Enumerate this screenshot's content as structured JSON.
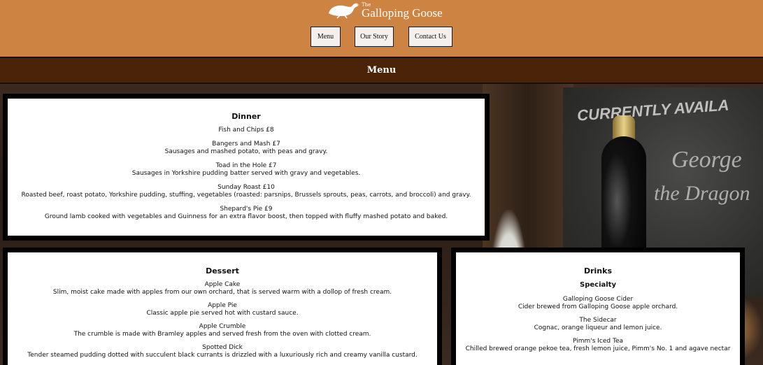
{
  "header": {
    "logo_small": "The",
    "logo_name": "Galloping Goose",
    "nav": [
      "Menu",
      "Our Story",
      "Contact Us"
    ]
  },
  "title_bar": {
    "title": "Menu"
  },
  "background": {
    "chalk_lines": [
      "CURRENTLY AVAILA",
      "George",
      "the Dragon"
    ]
  },
  "dinner": {
    "heading": "Dinner",
    "items": [
      {
        "name": "Fish and Chips £8",
        "desc": ""
      },
      {
        "name": "Bangers and Mash £7",
        "desc": "Sausages and mashed potato, with peas and gravy."
      },
      {
        "name": "Toad in the Hole £7",
        "desc": "Sausages in Yorkshire pudding batter served with gravy and vegetables."
      },
      {
        "name": "Sunday Roast £10",
        "desc": "Roasted beef, roast potato, Yorkshire pudding, stuffing, vegetables (roasted: parsnips, Brussels sprouts, peas, carrots, and broccoli) and gravy."
      },
      {
        "name": "Shepard's Pie £9",
        "desc": "Ground lamb cooked with vegetables and Guinness for an extra flavor boost, then topped with fluffy mashed potato and baked."
      }
    ]
  },
  "dessert": {
    "heading": "Dessert",
    "items": [
      {
        "name": "Apple Cake",
        "desc": "Slim, moist cake made with apples from our own orchard, that is served warm with a dollop of fresh cream."
      },
      {
        "name": "Apple Pie",
        "desc": "Classic apple pie served hot with custard sauce."
      },
      {
        "name": "Apple Crumble",
        "desc": "The crumble is made with Bramley apples and served fresh from the oven with clotted cream."
      },
      {
        "name": "Spotted Dick",
        "desc": "Tender steamed pudding dotted with succulent black currants is drizzled with a luxuriously rich and creamy vanilla custard."
      }
    ]
  },
  "drinks": {
    "heading": "Drinks",
    "subheading": "Specialty",
    "items": [
      {
        "name": "Galloping Goose Cider",
        "desc": "Cider brewed from Galloping Goose apple orchard."
      },
      {
        "name": "The Sidecar",
        "desc": "Cognac, orange liqueur and lemon juice."
      },
      {
        "name": "Pimm's Iced Tea",
        "desc": "Chilled brewed orange pekoe tea, fresh lemon juice, Pimm's No. 1 and agave nectar"
      }
    ]
  }
}
